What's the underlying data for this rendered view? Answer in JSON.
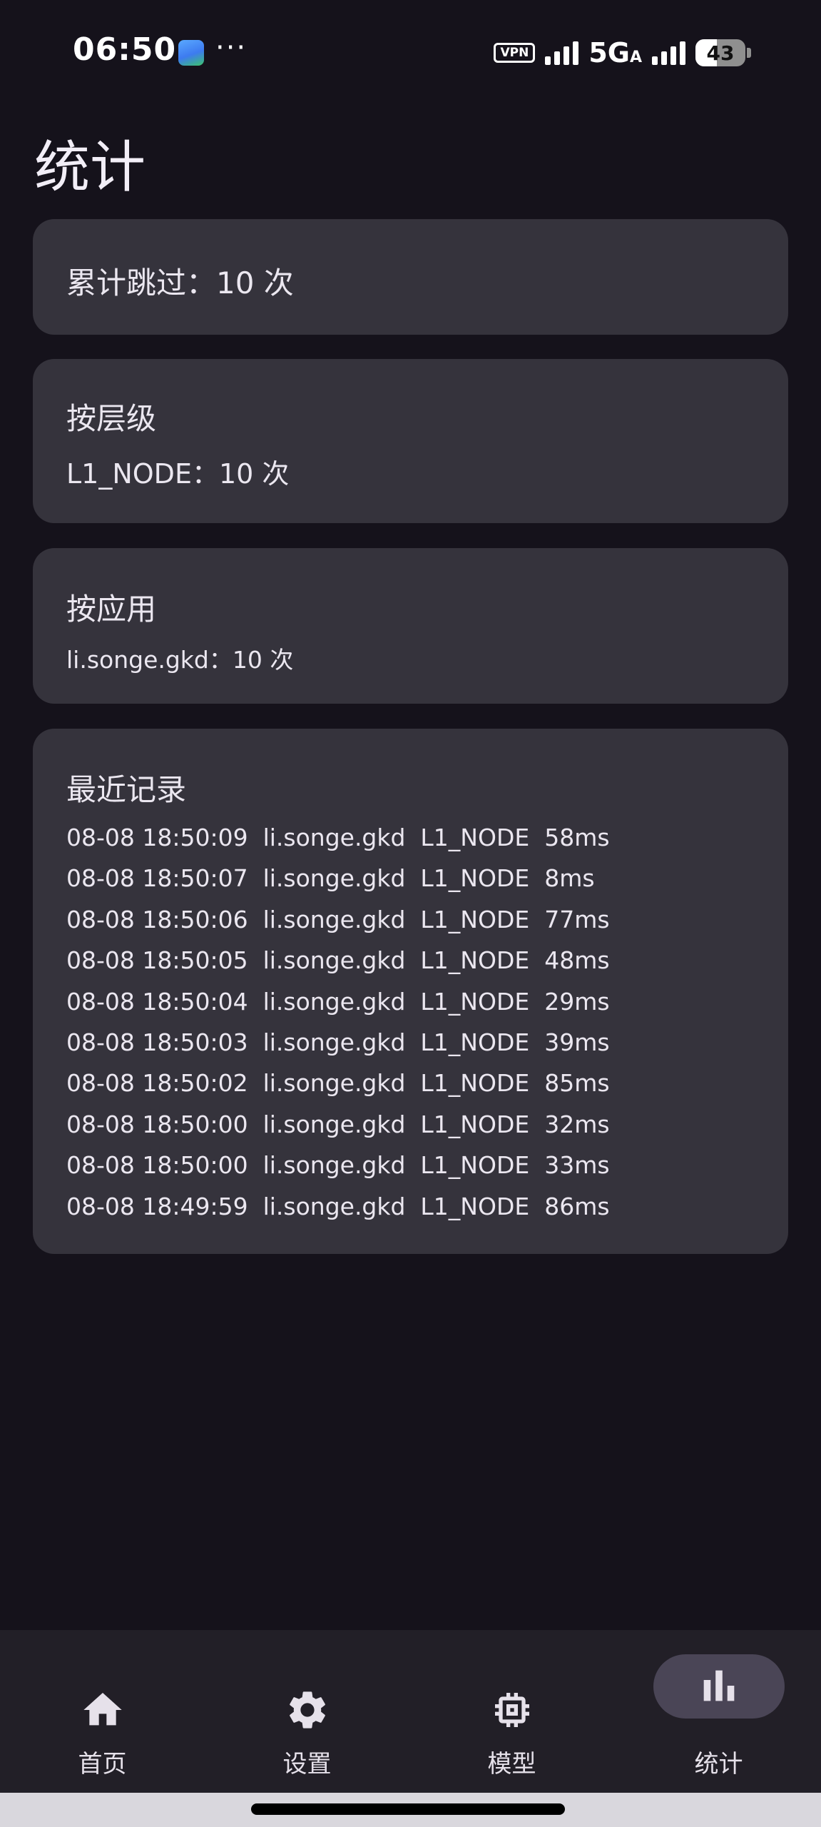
{
  "status_bar": {
    "time": "06:50",
    "app_icon": "gallery-app-icon",
    "more": "···",
    "vpn": "VPN",
    "network_main": "5G",
    "network_sub": "A",
    "battery_level": "43",
    "battery_fraction": 0.43
  },
  "page": {
    "title": "统计"
  },
  "total_card": {
    "text": "累计跳过：10 次"
  },
  "level_card": {
    "heading": "按层级",
    "items": [
      "L1_NODE：10 次"
    ]
  },
  "app_card": {
    "heading": "按应用",
    "items": [
      "li.songe.gkd：10 次"
    ]
  },
  "recent_card": {
    "heading": "最近记录",
    "rows": [
      "08-08 18:50:09  li.songe.gkd  L1_NODE  58ms",
      "08-08 18:50:07  li.songe.gkd  L1_NODE  8ms",
      "08-08 18:50:06  li.songe.gkd  L1_NODE  77ms",
      "08-08 18:50:05  li.songe.gkd  L1_NODE  48ms",
      "08-08 18:50:04  li.songe.gkd  L1_NODE  29ms",
      "08-08 18:50:03  li.songe.gkd  L1_NODE  39ms",
      "08-08 18:50:02  li.songe.gkd  L1_NODE  85ms",
      "08-08 18:50:00  li.songe.gkd  L1_NODE  32ms",
      "08-08 18:50:00  li.songe.gkd  L1_NODE  33ms",
      "08-08 18:49:59  li.songe.gkd  L1_NODE  86ms"
    ]
  },
  "bottom_nav": {
    "items": [
      {
        "label": "首页",
        "icon": "home-icon",
        "active": false
      },
      {
        "label": "设置",
        "icon": "gear-icon",
        "active": false
      },
      {
        "label": "模型",
        "icon": "chip-icon",
        "active": false
      },
      {
        "label": "统计",
        "icon": "bar-chart-icon",
        "active": true
      }
    ]
  },
  "colors": {
    "background": "#15121b",
    "card": "#35333c",
    "nav_background": "#221f27",
    "active_pill": "#4a4556",
    "text": "#ebe7f0"
  }
}
